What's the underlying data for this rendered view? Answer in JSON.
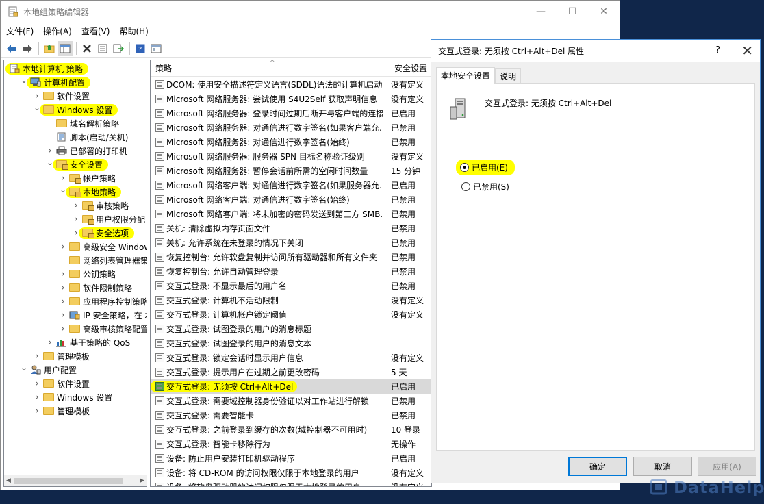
{
  "main_window": {
    "title": "本地组策略编辑器",
    "controls": {
      "minimize": "—",
      "maximize": "☐",
      "close": "✕"
    },
    "menu": [
      "文件(F)",
      "操作(A)",
      "查看(V)",
      "帮助(H)"
    ]
  },
  "tree": {
    "items": [
      {
        "label": "本地计算机 策略",
        "level": 0,
        "expand": "",
        "icon": "policy-icon",
        "highlight": true
      },
      {
        "label": "计算机配置",
        "level": 1,
        "expand": "open",
        "icon": "computer-icon",
        "highlight": true
      },
      {
        "label": "软件设置",
        "level": 2,
        "expand": "closed",
        "icon": "folder"
      },
      {
        "label": "Windows 设置",
        "level": 2,
        "expand": "open",
        "icon": "folder",
        "highlight": true
      },
      {
        "label": "域名解析策略",
        "level": 3,
        "expand": "",
        "icon": "folder"
      },
      {
        "label": "脚本(启动/关机)",
        "level": 3,
        "expand": "",
        "icon": "script-icon"
      },
      {
        "label": "已部署的打印机",
        "level": 3,
        "expand": "closed",
        "icon": "printer-icon"
      },
      {
        "label": "安全设置",
        "level": 3,
        "expand": "open",
        "icon": "folder-lock",
        "highlight": true
      },
      {
        "label": "帐户策略",
        "level": 4,
        "expand": "closed",
        "icon": "folder-lock"
      },
      {
        "label": "本地策略",
        "level": 4,
        "expand": "open",
        "icon": "folder-lock",
        "highlight": true
      },
      {
        "label": "审核策略",
        "level": 5,
        "expand": "closed",
        "icon": "folder-lock"
      },
      {
        "label": "用户权限分配",
        "level": 5,
        "expand": "closed",
        "icon": "folder-lock"
      },
      {
        "label": "安全选项",
        "level": 5,
        "expand": "closed",
        "icon": "folder-lock",
        "highlight": true
      },
      {
        "label": "高级安全 Windows",
        "level": 4,
        "expand": "closed",
        "icon": "folder"
      },
      {
        "label": "网络列表管理器策略",
        "level": 4,
        "expand": "",
        "icon": "folder"
      },
      {
        "label": "公钥策略",
        "level": 4,
        "expand": "closed",
        "icon": "folder"
      },
      {
        "label": "软件限制策略",
        "level": 4,
        "expand": "closed",
        "icon": "folder"
      },
      {
        "label": "应用程序控制策略",
        "level": 4,
        "expand": "closed",
        "icon": "folder"
      },
      {
        "label": "IP 安全策略，在 本地",
        "level": 4,
        "expand": "closed",
        "icon": "ipsec-icon"
      },
      {
        "label": "高级审核策略配置",
        "level": 4,
        "expand": "closed",
        "icon": "folder"
      },
      {
        "label": "基于策略的 QoS",
        "level": 3,
        "expand": "closed",
        "icon": "chart-icon"
      },
      {
        "label": "管理模板",
        "level": 2,
        "expand": "closed",
        "icon": "folder"
      },
      {
        "label": "用户配置",
        "level": 1,
        "expand": "open",
        "icon": "user-icon"
      },
      {
        "label": "软件设置",
        "level": 2,
        "expand": "closed",
        "icon": "folder"
      },
      {
        "label": "Windows 设置",
        "level": 2,
        "expand": "closed",
        "icon": "folder"
      },
      {
        "label": "管理模板",
        "level": 2,
        "expand": "closed",
        "icon": "folder"
      }
    ]
  },
  "list": {
    "headers": {
      "policy": "策略",
      "setting": "安全设置"
    },
    "rows": [
      {
        "name": "DCOM: 使用安全描述符定义语言(SDDL)语法的计算机启动...",
        "value": "没有定义"
      },
      {
        "name": "Microsoft 网络服务器: 尝试使用 S4U2Self 获取声明信息",
        "value": "没有定义"
      },
      {
        "name": "Microsoft 网络服务器: 登录时间过期后断开与客户端的连接",
        "value": "已启用"
      },
      {
        "name": "Microsoft 网络服务器: 对通信进行数字签名(如果客户端允...",
        "value": "已禁用"
      },
      {
        "name": "Microsoft 网络服务器: 对通信进行数字签名(始终)",
        "value": "已禁用"
      },
      {
        "name": "Microsoft 网络服务器: 服务器 SPN 目标名称验证级别",
        "value": "没有定义"
      },
      {
        "name": "Microsoft 网络服务器: 暂停会话前所需的空闲时间数量",
        "value": "15 分钟"
      },
      {
        "name": "Microsoft 网络客户端: 对通信进行数字签名(如果服务器允...",
        "value": "已启用"
      },
      {
        "name": "Microsoft 网络客户端: 对通信进行数字签名(始终)",
        "value": "已禁用"
      },
      {
        "name": "Microsoft 网络客户端: 将未加密的密码发送到第三方 SMB...",
        "value": "已禁用"
      },
      {
        "name": "关机: 清除虚拟内存页面文件",
        "value": "已禁用"
      },
      {
        "name": "关机: 允许系统在未登录的情况下关闭",
        "value": "已禁用"
      },
      {
        "name": "恢复控制台: 允许软盘复制并访问所有驱动器和所有文件夹",
        "value": "已禁用"
      },
      {
        "name": "恢复控制台: 允许自动管理登录",
        "value": "已禁用"
      },
      {
        "name": "交互式登录: 不显示最后的用户名",
        "value": "已禁用"
      },
      {
        "name": "交互式登录: 计算机不活动限制",
        "value": "没有定义"
      },
      {
        "name": "交互式登录: 计算机帐户锁定阈值",
        "value": "没有定义"
      },
      {
        "name": "交互式登录: 试图登录的用户的消息标题",
        "value": ""
      },
      {
        "name": "交互式登录: 试图登录的用户的消息文本",
        "value": ""
      },
      {
        "name": "交互式登录: 锁定会话时显示用户信息",
        "value": "没有定义"
      },
      {
        "name": "交互式登录: 提示用户在过期之前更改密码",
        "value": "5 天"
      },
      {
        "name": "交互式登录: 无须按 Ctrl+Alt+Del",
        "value": "已启用",
        "selected": true
      },
      {
        "name": "交互式登录: 需要域控制器身份验证以对工作站进行解锁",
        "value": "已禁用"
      },
      {
        "name": "交互式登录: 需要智能卡",
        "value": "已禁用"
      },
      {
        "name": "交互式登录: 之前登录到缓存的次数(域控制器不可用时)",
        "value": "10 登录"
      },
      {
        "name": "交互式登录: 智能卡移除行为",
        "value": "无操作"
      },
      {
        "name": "设备: 防止用户安装打印机驱动程序",
        "value": "已启用"
      },
      {
        "name": "设备: 将 CD-ROM 的访问权限仅限于本地登录的用户",
        "value": "没有定义"
      },
      {
        "name": "设备: 将软盘驱动器的访问权限仅限于本地登录的用户",
        "value": "没有定义"
      }
    ]
  },
  "dialog": {
    "title": "交互式登录: 无须按 Ctrl+Alt+Del 属性",
    "help": "?",
    "close": "✕",
    "tabs": [
      "本地安全设置",
      "说明"
    ],
    "policy_name": "交互式登录: 无须按 Ctrl+Alt+Del",
    "option_enabled": "已启用(E)",
    "option_disabled": "已禁用(S)",
    "selected_option": "enabled",
    "buttons": {
      "ok": "确定",
      "cancel": "取消",
      "apply": "应用(A)"
    }
  },
  "watermark": {
    "text": "DataHelp"
  },
  "colors": {
    "highlight": "#ffff00",
    "folder": "#f3cd5e",
    "dialog_bg": "#f0f0f0",
    "accent": "#0078d7",
    "desktop": "#10264a"
  }
}
